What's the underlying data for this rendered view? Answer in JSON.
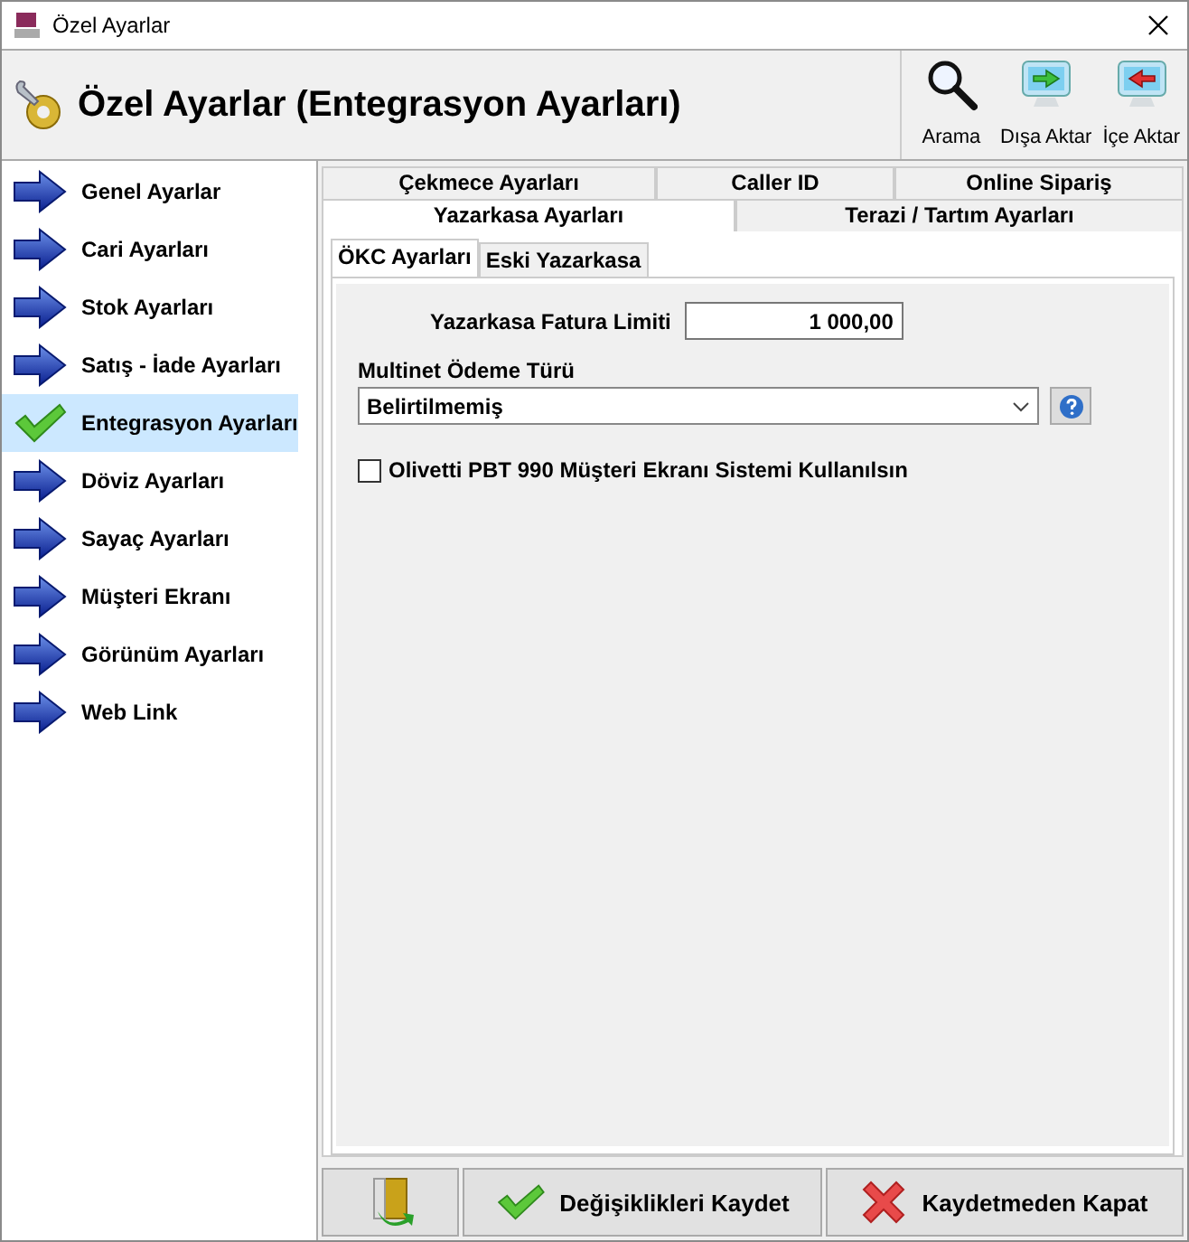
{
  "window": {
    "title": "Özel Ayarlar"
  },
  "header": {
    "title": "Özel Ayarlar (Entegrasyon Ayarları)",
    "tools": [
      {
        "kind": "search",
        "label": "Arama"
      },
      {
        "kind": "export",
        "label": "Dışa Aktar"
      },
      {
        "kind": "import",
        "label": "İçe Aktar"
      }
    ]
  },
  "sidebar": {
    "items": [
      {
        "label": "Genel Ayarlar",
        "selected": false
      },
      {
        "label": "Cari Ayarları",
        "selected": false
      },
      {
        "label": "Stok Ayarları",
        "selected": false
      },
      {
        "label": "Satış - İade Ayarları",
        "selected": false
      },
      {
        "label": "Entegrasyon Ayarları",
        "selected": true
      },
      {
        "label": "Döviz Ayarları",
        "selected": false
      },
      {
        "label": "Sayaç Ayarları",
        "selected": false
      },
      {
        "label": "Müşteri Ekranı",
        "selected": false
      },
      {
        "label": "Görünüm Ayarları",
        "selected": false
      },
      {
        "label": "Web Link",
        "selected": false
      }
    ]
  },
  "tab_rows": [
    {
      "tabs": [
        {
          "label": "Çekmece Ayarları",
          "selected": false
        },
        {
          "label": "Caller ID",
          "selected": false
        },
        {
          "label": "Online Sipariş",
          "selected": false
        }
      ]
    },
    {
      "tabs": [
        {
          "label": "Yazarkasa Ayarları",
          "selected": true
        },
        {
          "label": "Terazi / Tartım Ayarları",
          "selected": false
        }
      ]
    }
  ],
  "subtabs": [
    {
      "label": "ÖKC Ayarları",
      "selected": true
    },
    {
      "label": "Eski Yazarkasa",
      "selected": false
    }
  ],
  "form": {
    "limit": {
      "label": "Yazarkasa Fatura Limiti",
      "value": "1 000,00"
    },
    "payment_type": {
      "label": "Multinet Ödeme Türü",
      "value": "Belirtilmemiş"
    },
    "option": {
      "label": "Olivetti PBT 990 Müşteri Ekranı Sistemi Kullanılsın",
      "checked": false
    }
  },
  "buttons": [
    {
      "kind": "exit"
    },
    {
      "kind": "save",
      "label": "Değişiklikleri Kaydet"
    },
    {
      "kind": "cancel",
      "label": "Kaydetmeden Kapat"
    }
  ]
}
